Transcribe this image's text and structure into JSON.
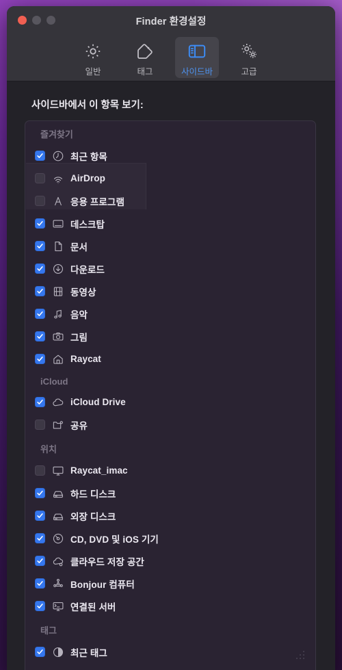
{
  "window": {
    "title": "Finder 환경설정",
    "traffic_lights": [
      "close",
      "minimize",
      "maximize"
    ],
    "accent_color": "#3577ee",
    "close_color": "#f15f52",
    "titlebar_color": "#35343a",
    "body_color": "#232228"
  },
  "toolbar": {
    "items": [
      {
        "label": "일반",
        "icon": "gear-icon",
        "active": false
      },
      {
        "label": "태그",
        "icon": "tag-icon",
        "active": false
      },
      {
        "label": "사이드바",
        "icon": "sidebar-icon",
        "active": true
      },
      {
        "label": "고급",
        "icon": "gears-icon",
        "active": false
      }
    ]
  },
  "pane": {
    "title": "사이드바에서 이 항목 보기:",
    "groups": [
      {
        "name": "즐겨찾기",
        "items": [
          {
            "label": "최근 항목",
            "icon": "clock-icon",
            "checked": true
          },
          {
            "label": "AirDrop",
            "icon": "airdrop-icon",
            "checked": false
          },
          {
            "label": "응용 프로그램",
            "icon": "applications-icon",
            "checked": false
          },
          {
            "label": "데스크탑",
            "icon": "desktop-icon",
            "checked": true
          },
          {
            "label": "문서",
            "icon": "document-icon",
            "checked": true
          },
          {
            "label": "다운로드",
            "icon": "download-icon",
            "checked": true
          },
          {
            "label": "동영상",
            "icon": "movie-icon",
            "checked": true
          },
          {
            "label": "음악",
            "icon": "music-icon",
            "checked": true
          },
          {
            "label": "그림",
            "icon": "camera-icon",
            "checked": true
          },
          {
            "label": "Raycat",
            "icon": "home-icon",
            "checked": true
          }
        ]
      },
      {
        "name": "iCloud",
        "items": [
          {
            "label": "iCloud Drive",
            "icon": "cloud-icon",
            "checked": true
          },
          {
            "label": "공유",
            "icon": "shared-folder-icon",
            "checked": false
          }
        ]
      },
      {
        "name": "위치",
        "items": [
          {
            "label": "Raycat_imac",
            "icon": "imac-icon",
            "checked": false
          },
          {
            "label": "하드 디스크",
            "icon": "harddisk-icon",
            "checked": true
          },
          {
            "label": "외장 디스크",
            "icon": "externaldisk-icon",
            "checked": true
          },
          {
            "label": "CD, DVD 및 iOS 기기",
            "icon": "disc-icon",
            "checked": true
          },
          {
            "label": "클라우드 저장 공간",
            "icon": "cloudstorage-icon",
            "checked": true
          },
          {
            "label": "Bonjour 컴퓨터",
            "icon": "bonjour-icon",
            "checked": true
          },
          {
            "label": "연결된 서버",
            "icon": "server-icon",
            "checked": true
          }
        ]
      },
      {
        "name": "태그",
        "items": [
          {
            "label": "최근 태그",
            "icon": "tags-circle-icon",
            "checked": true
          }
        ]
      }
    ]
  }
}
